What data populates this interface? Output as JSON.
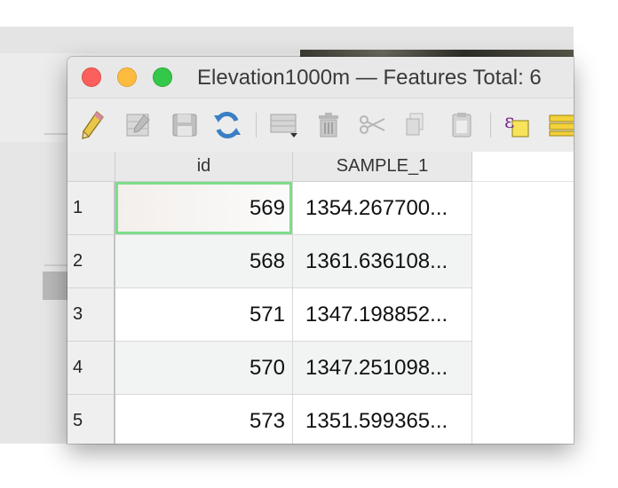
{
  "window": {
    "title": "Elevation1000m — Features Total: 6"
  },
  "toolbar": {
    "buttons": [
      {
        "name": "toggle-editing",
        "icon": "pencil-icon"
      },
      {
        "name": "multi-edit",
        "icon": "edit-table-icon"
      },
      {
        "name": "save-edits",
        "icon": "save-icon"
      },
      {
        "name": "reload-table",
        "icon": "refresh-icon"
      },
      {
        "name": "add-feature",
        "icon": "add-row-icon"
      },
      {
        "name": "delete-selected",
        "icon": "trash-icon"
      },
      {
        "name": "cut-selected",
        "icon": "scissors-icon"
      },
      {
        "name": "copy-selected",
        "icon": "copy-icon"
      },
      {
        "name": "paste-features",
        "icon": "paste-icon"
      },
      {
        "name": "select-by-expression",
        "icon": "expression-select-icon"
      },
      {
        "name": "select-all",
        "icon": "select-all-icon"
      }
    ]
  },
  "table": {
    "columns": [
      "id",
      "SAMPLE_1"
    ],
    "rows": [
      {
        "num": "1",
        "id": "569",
        "sample": "1354.267700..."
      },
      {
        "num": "2",
        "id": "568",
        "sample": "1361.636108..."
      },
      {
        "num": "3",
        "id": "571",
        "sample": "1347.198852..."
      },
      {
        "num": "4",
        "id": "570",
        "sample": "1347.251098..."
      },
      {
        "num": "5",
        "id": "573",
        "sample": "1351.599365..."
      }
    ]
  }
}
